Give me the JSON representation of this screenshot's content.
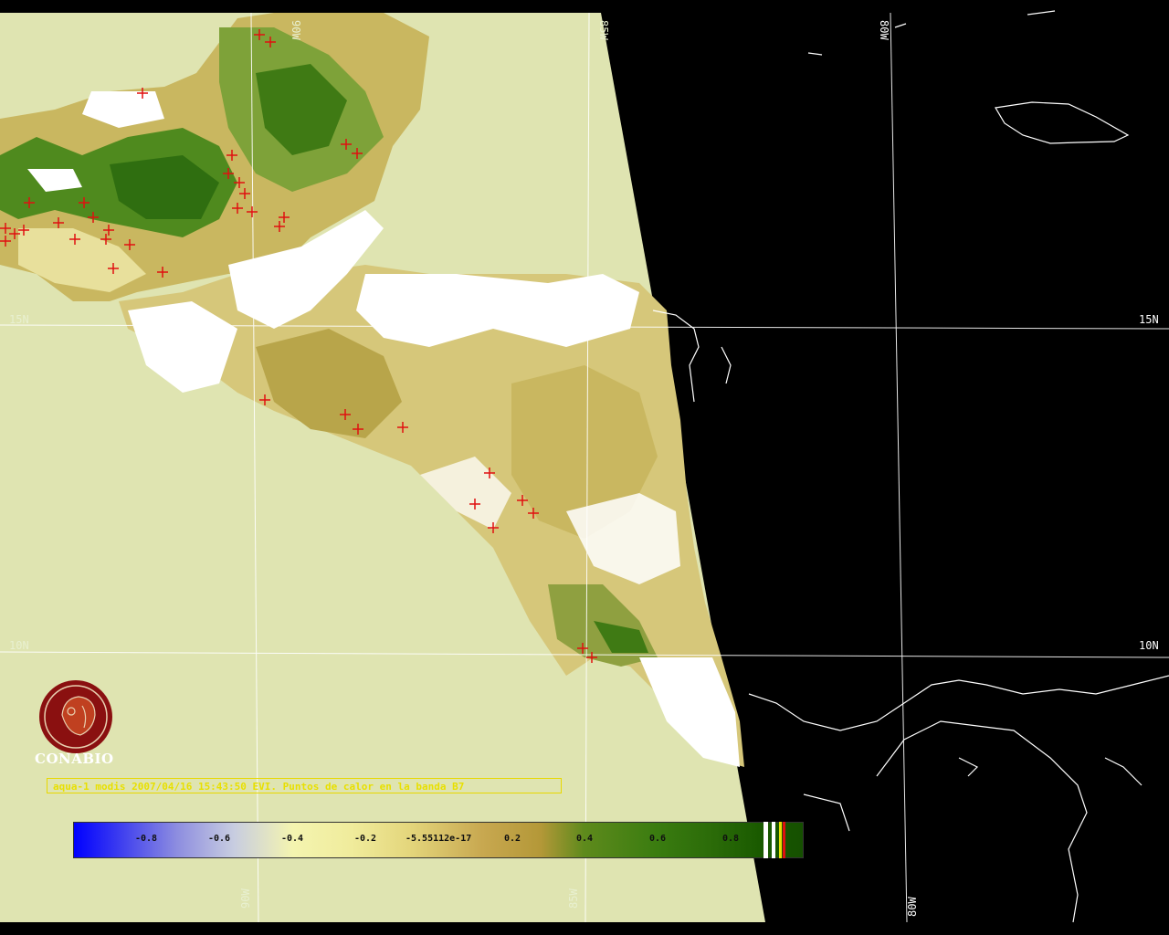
{
  "grid_labels": {
    "lon_90w": "90W",
    "lon_85w": "85W",
    "lon_80w": "80W",
    "lat_15n": "15N",
    "lat_10n": "10N"
  },
  "logo": {
    "name": "CONABIO"
  },
  "caption": "aqua-1 modis 2007/04/16 15:43:50 EVI. Puntos de calor en la banda B7",
  "colorbar": {
    "ticks": [
      "-0.8",
      "-0.6",
      "-0.4",
      "-0.2",
      "-5.55112e-17",
      "0.2",
      "0.4",
      "0.6",
      "0.8"
    ]
  },
  "colors": {
    "ocean_in_swath": "#dfe4b1",
    "outside_swath": "#000000",
    "cloud": "#ffffff",
    "vegetation_high": "#3f7a14",
    "vegetation_mid": "#b8a54a",
    "vegetation_low": "#e8e09c",
    "hotspot": "#e01010",
    "graticule": "#ffffff",
    "caption_text": "#e8e000"
  }
}
